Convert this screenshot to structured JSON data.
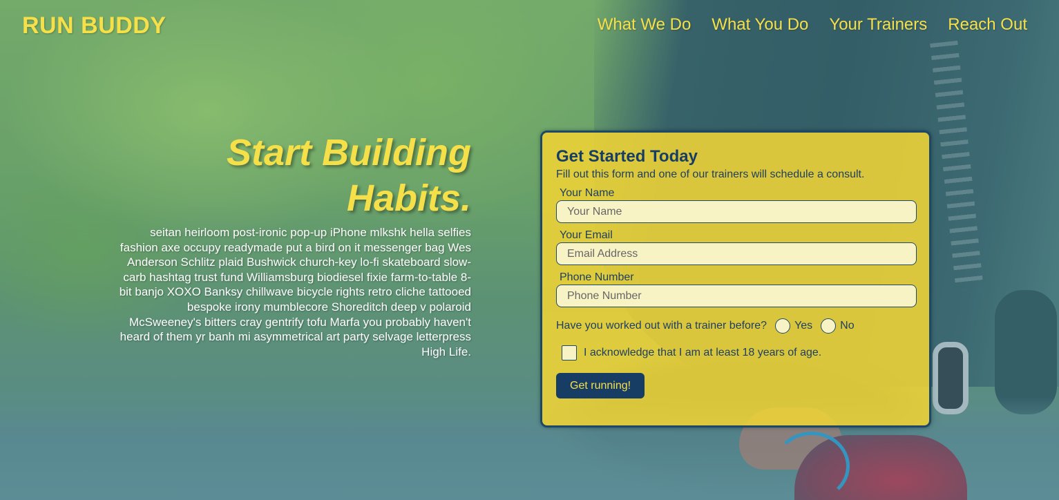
{
  "header": {
    "logo": "RUN BUDDY",
    "nav": [
      {
        "label": "What We Do"
      },
      {
        "label": "What You Do"
      },
      {
        "label": "Your Trainers"
      },
      {
        "label": "Reach Out"
      }
    ]
  },
  "hero": {
    "title_line1": "Start Building",
    "title_line2": "Habits.",
    "body": "seitan heirloom post-ironic pop-up iPhone mlkshk hella selfies fashion axe occupy readymade put a bird on it messenger bag Wes Anderson Schlitz plaid Bushwick church-key lo-fi skateboard slow-carb hashtag trust fund Williamsburg biodiesel fixie farm-to-table 8-bit banjo XOXO Banksy chillwave bicycle rights retro cliche tattooed bespoke irony mumblecore Shoreditch deep v polaroid McSweeney's bitters cray gentrify tofu Marfa you probably haven't heard of them yr banh mi asymmetrical art party selvage letterpress High Life."
  },
  "form": {
    "title": "Get Started Today",
    "subtitle": "Fill out this form and one of our trainers will schedule a consult.",
    "name": {
      "label": "Your Name",
      "placeholder": "Your Name",
      "value": ""
    },
    "email": {
      "label": "Your Email",
      "placeholder": "Email Address",
      "value": ""
    },
    "phone": {
      "label": "Phone Number",
      "placeholder": "Phone Number",
      "value": ""
    },
    "trainer_question": "Have you worked out with a trainer before?",
    "option_yes": "Yes",
    "option_no": "No",
    "age_ack": "I acknowledge that I am at least 18 years of age.",
    "submit_label": "Get running!"
  },
  "colors": {
    "accent_yellow": "#f6e04a",
    "navy": "#183d64",
    "field_bg": "#f8f3c5"
  }
}
